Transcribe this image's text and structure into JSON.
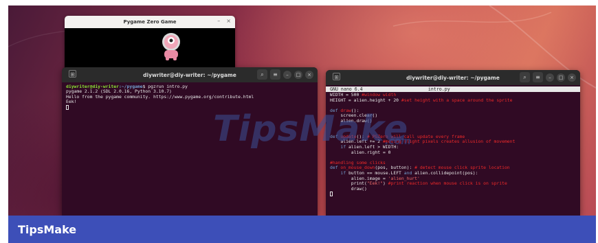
{
  "watermark": {
    "text": "TipsMake",
    "suffix": ".com"
  },
  "pygame_window": {
    "title": "Pygame Zero Game",
    "controls": [
      "–",
      "×"
    ]
  },
  "terminal_left": {
    "title": "diywriter@diy-writer: ~/pygame",
    "icon": "terminal-tab-icon",
    "controls": [
      "⌕",
      "≡",
      "–",
      "□",
      "×"
    ],
    "lines": [
      {
        "user": "diywriter@diy-writer",
        "path": ":~/pygame",
        "cmd": "$ pgzrun intro.py"
      },
      {
        "text": "pygame 2.1.2 (SDL 2.0.16, Python 3.10.7)"
      },
      {
        "text": "Hello from the pygame community. https://www.pygame.org/contribute.html"
      },
      {
        "text": "Eek!"
      }
    ]
  },
  "terminal_right": {
    "title": "diywriter@diy-writer: ~/pygame",
    "controls": [
      "⌕",
      "≡",
      "–",
      "□",
      "×"
    ],
    "nano_version": "GNU nano 6.4",
    "filename": "intro.py",
    "code": [
      [
        {
          "t": "WIDTH = 500 "
        },
        {
          "c": "cm",
          "t": "#window width"
        }
      ],
      [
        {
          "t": "HEIGHT = alien.height + 20 "
        },
        {
          "c": "cm",
          "t": "#set height with a space around the sprite"
        }
      ],
      [
        {
          "t": ""
        }
      ],
      [
        {
          "c": "kw",
          "t": "def "
        },
        {
          "c": "cm",
          "t": "draw"
        },
        {
          "t": "():"
        }
      ],
      [
        {
          "t": "    screen.clear()"
        }
      ],
      [
        {
          "t": "    alien.draw()"
        }
      ],
      [
        {
          "t": ""
        }
      ],
      [
        {
          "t": ""
        }
      ],
      [
        {
          "c": "kw",
          "t": "def "
        },
        {
          "c": "cm",
          "t": "update"
        },
        {
          "t": "(): "
        },
        {
          "c": "cm",
          "t": "# PGZero will call update every frame"
        }
      ],
      [
        {
          "t": "    alien.left += 2 "
        },
        {
          "c": "cm",
          "t": "#moving slight pixels creates allusion of movement"
        }
      ],
      [
        {
          "t": "    "
        },
        {
          "c": "kw",
          "t": "if"
        },
        {
          "t": " alien.left > WIDTH:"
        }
      ],
      [
        {
          "t": "        alien.right = 0"
        }
      ],
      [
        {
          "t": ""
        }
      ],
      [
        {
          "c": "cm",
          "t": "#handling some clicks"
        }
      ],
      [
        {
          "c": "kw",
          "t": "def "
        },
        {
          "c": "cm",
          "t": "on_mouse_down"
        },
        {
          "t": "(pos, button): "
        },
        {
          "c": "cm",
          "t": "# detect mouse click sprite location"
        }
      ],
      [
        {
          "t": "    "
        },
        {
          "c": "kw",
          "t": "if"
        },
        {
          "t": " button == mouse.LEFT "
        },
        {
          "c": "kw",
          "t": "and"
        },
        {
          "t": " alien.collidepoint(pos):"
        }
      ],
      [
        {
          "t": "        alien.image = "
        },
        {
          "c": "st",
          "t": "'alien_hurt'"
        }
      ],
      [
        {
          "t": "        print("
        },
        {
          "c": "st",
          "t": "\"Eek!\""
        },
        {
          "t": ") "
        },
        {
          "c": "cm",
          "t": "#print reaction when mouse click is on sprite"
        }
      ],
      [
        {
          "t": "        draw()"
        }
      ]
    ]
  },
  "footer": {
    "brand": "TipsMake"
  },
  "colors": {
    "terminal_bg": "#300a24",
    "footer_bg": "#3d4fb8",
    "prompt_user": "#8ae234",
    "prompt_path": "#729fcf"
  }
}
